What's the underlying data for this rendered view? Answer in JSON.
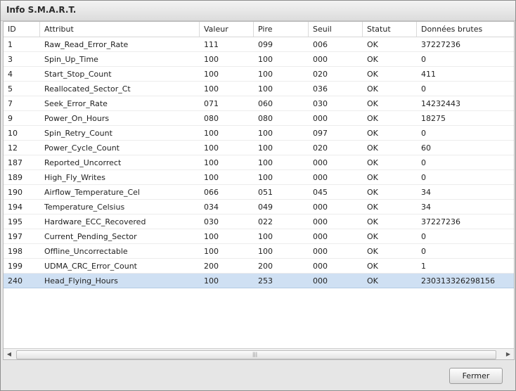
{
  "window": {
    "title": "Info S.M.A.R.T."
  },
  "table": {
    "headers": {
      "id": "ID",
      "attribut": "Attribut",
      "valeur": "Valeur",
      "pire": "Pire",
      "seuil": "Seuil",
      "statut": "Statut",
      "donnees": "Données brutes"
    },
    "rows": [
      {
        "id": "1",
        "attribut": "Raw_Read_Error_Rate",
        "valeur": "111",
        "pire": "099",
        "seuil": "006",
        "statut": "OK",
        "donnees": "37227236"
      },
      {
        "id": "3",
        "attribut": "Spin_Up_Time",
        "valeur": "100",
        "pire": "100",
        "seuil": "000",
        "statut": "OK",
        "donnees": "0"
      },
      {
        "id": "4",
        "attribut": "Start_Stop_Count",
        "valeur": "100",
        "pire": "100",
        "seuil": "020",
        "statut": "OK",
        "donnees": "411"
      },
      {
        "id": "5",
        "attribut": "Reallocated_Sector_Ct",
        "valeur": "100",
        "pire": "100",
        "seuil": "036",
        "statut": "OK",
        "donnees": "0"
      },
      {
        "id": "7",
        "attribut": "Seek_Error_Rate",
        "valeur": "071",
        "pire": "060",
        "seuil": "030",
        "statut": "OK",
        "donnees": "14232443"
      },
      {
        "id": "9",
        "attribut": "Power_On_Hours",
        "valeur": "080",
        "pire": "080",
        "seuil": "000",
        "statut": "OK",
        "donnees": "18275"
      },
      {
        "id": "10",
        "attribut": "Spin_Retry_Count",
        "valeur": "100",
        "pire": "100",
        "seuil": "097",
        "statut": "OK",
        "donnees": "0"
      },
      {
        "id": "12",
        "attribut": "Power_Cycle_Count",
        "valeur": "100",
        "pire": "100",
        "seuil": "020",
        "statut": "OK",
        "donnees": "60"
      },
      {
        "id": "187",
        "attribut": "Reported_Uncorrect",
        "valeur": "100",
        "pire": "100",
        "seuil": "000",
        "statut": "OK",
        "donnees": "0"
      },
      {
        "id": "189",
        "attribut": "High_Fly_Writes",
        "valeur": "100",
        "pire": "100",
        "seuil": "000",
        "statut": "OK",
        "donnees": "0"
      },
      {
        "id": "190",
        "attribut": "Airflow_Temperature_Cel",
        "valeur": "066",
        "pire": "051",
        "seuil": "045",
        "statut": "OK",
        "donnees": "34"
      },
      {
        "id": "194",
        "attribut": "Temperature_Celsius",
        "valeur": "034",
        "pire": "049",
        "seuil": "000",
        "statut": "OK",
        "donnees": "34"
      },
      {
        "id": "195",
        "attribut": "Hardware_ECC_Recovered",
        "valeur": "030",
        "pire": "022",
        "seuil": "000",
        "statut": "OK",
        "donnees": "37227236"
      },
      {
        "id": "197",
        "attribut": "Current_Pending_Sector",
        "valeur": "100",
        "pire": "100",
        "seuil": "000",
        "statut": "OK",
        "donnees": "0"
      },
      {
        "id": "198",
        "attribut": "Offline_Uncorrectable",
        "valeur": "100",
        "pire": "100",
        "seuil": "000",
        "statut": "OK",
        "donnees": "0"
      },
      {
        "id": "199",
        "attribut": "UDMA_CRC_Error_Count",
        "valeur": "200",
        "pire": "200",
        "seuil": "000",
        "statut": "OK",
        "donnees": "1"
      },
      {
        "id": "240",
        "attribut": "Head_Flying_Hours",
        "valeur": "100",
        "pire": "253",
        "seuil": "000",
        "statut": "OK",
        "donnees": "230313326298156"
      }
    ],
    "selected_row": 16
  },
  "scrollbar": {
    "left_arrow": "◀",
    "right_arrow": "▶",
    "grip": "|||"
  },
  "footer": {
    "close_label": "Fermer"
  },
  "colors": {
    "selection": "#cfe0f3",
    "window_bg": "#e6e6e6"
  }
}
